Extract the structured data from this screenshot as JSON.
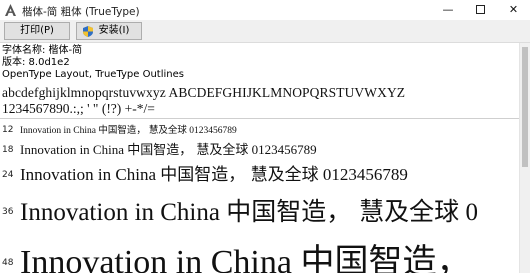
{
  "window": {
    "title": "楷体-简 粗体 (TrueType)",
    "minimize_glyph": "—",
    "close_glyph": "✕"
  },
  "toolbar": {
    "print_label": "打印(P)",
    "install_label": "安装(I)"
  },
  "info": {
    "font_name": "字体名称: 楷体-简",
    "version": "版本: 8.0d1e2",
    "outline": "OpenType Layout, TrueType Outlines"
  },
  "samples": {
    "alphabet": "abcdefghijklmnopqrstuvwxyz ABCDEFGHIJKLMNOPQRSTUVWXYZ",
    "numerals": "1234567890.:,; ' \" (!?) +-*/="
  },
  "size_rows": [
    {
      "size": "12",
      "latin": "Innovation in China",
      "cjk": "中国智造， 慧及全球",
      "digits": "0123456789"
    },
    {
      "size": "18",
      "latin": "Innovation in China",
      "cjk": "中国智造， 慧及全球",
      "digits": "0123456789"
    },
    {
      "size": "24",
      "latin": "Innovation in China",
      "cjk": "中国智造， 慧及全球",
      "digits": "0123456789"
    },
    {
      "size": "36",
      "latin": "Innovation in China",
      "cjk": "中国智造， 慧及全球",
      "digits": "0"
    },
    {
      "size": "48",
      "latin": "Innovation in China",
      "cjk": "中国智造，",
      "digits": ""
    }
  ],
  "colors": {
    "toolbar_bg": "#f0f0f0",
    "button_bg": "#e1e1e1",
    "shield_blue": "#2f6fc4",
    "shield_yellow": "#f2c230"
  }
}
